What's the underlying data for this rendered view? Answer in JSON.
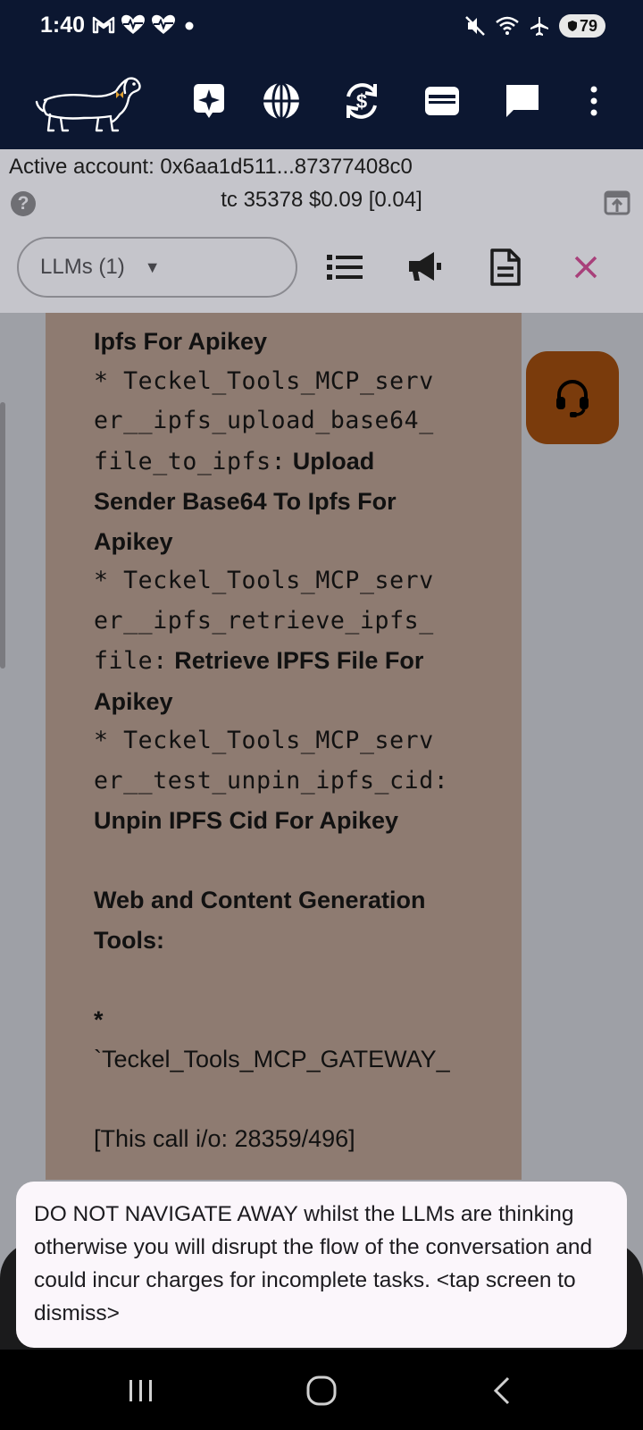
{
  "status_bar": {
    "time": "1:40",
    "battery": "79",
    "left_icons": [
      "gmail-icon",
      "heartbeat-icon",
      "heartbeat-icon",
      "dot-icon"
    ],
    "right_icons": [
      "mute-icon",
      "wifi-icon",
      "airplane-icon",
      "battery-icon"
    ]
  },
  "app_bar": {
    "logo": "dachshund-logo",
    "actions": [
      "sparkle-icon",
      "globe-icon",
      "currency-exchange-icon",
      "wallet-icon",
      "chat-icon",
      "more-vert-icon"
    ]
  },
  "account": {
    "active_account": "Active account: 0x6aa1d511...87377408c0",
    "token_line": "tc 35378 $0.09 [0.04]",
    "help": "?"
  },
  "controls": {
    "llm_select": "LLMs  (1)",
    "actions": [
      "list-icon",
      "megaphone-icon",
      "document-icon",
      "close-icon"
    ]
  },
  "message": {
    "l1": "Ipfs For Apikey",
    "l2a": "* Teckel_Tools_MCP_serv",
    "l2b": "er__ipfs_upload_base64_",
    "l2c": "file_to_ipfs:",
    "l2d": " Upload",
    "l3": "Sender Base64 To Ipfs For",
    "l4": "Apikey",
    "l5a": "* Teckel_Tools_MCP_serv",
    "l5b": "er__ipfs_retrieve_ipfs_",
    "l5c": "file:",
    "l5d": " Retrieve IPFS File For",
    "l6": "Apikey",
    "l7a": "* Teckel_Tools_MCP_serv",
    "l7b": "er__test_unpin_ipfs_cid:",
    "l8": "Unpin IPFS Cid For Apikey",
    "h1": "Web and Content Generation",
    "h2": "Tools:",
    "star": "*",
    "gateway": "`Teckel_Tools_MCP_GATEWAY_",
    "call_io": "[This call i/o: 28359/496]"
  },
  "toast": {
    "text": "DO NOT NAVIGATE AWAY whilst the LLMs are thinking otherwise you will disrupt the flow of the conversation and could incur charges for incomplete tasks. <tap screen to dismiss>"
  },
  "colors": {
    "app_bar": "#0c1731",
    "account_bg": "#c5c5cb",
    "message_bg": "#8e7b71",
    "fab": "#7a3b0c",
    "close_accent": "#a8407a"
  }
}
